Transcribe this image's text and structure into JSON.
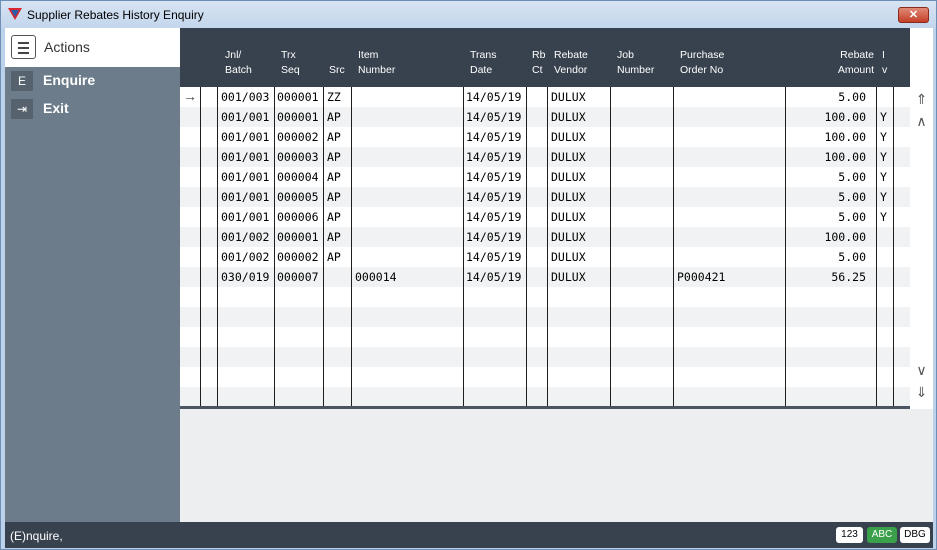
{
  "window": {
    "title": "Supplier Rebates History Enquiry",
    "close_label": "✕"
  },
  "sidebar": {
    "header": "Actions",
    "items": [
      {
        "icon": "E",
        "label": "Enquire"
      },
      {
        "icon": "⇥",
        "label": "Exit"
      }
    ]
  },
  "grid": {
    "columns": [
      {
        "key": "batch",
        "label": "Jnl/\nBatch"
      },
      {
        "key": "seq",
        "label": "Trx\nSeq"
      },
      {
        "key": "src",
        "label": "\nSrc"
      },
      {
        "key": "item",
        "label": "Item\nNumber"
      },
      {
        "key": "date",
        "label": "Trans\nDate"
      },
      {
        "key": "ct",
        "label": "Rb\nCt"
      },
      {
        "key": "vendor",
        "label": "Rebate\nVendor"
      },
      {
        "key": "job",
        "label": "Job\nNumber"
      },
      {
        "key": "po",
        "label": "Purchase\nOrder No"
      },
      {
        "key": "amount",
        "label": "Rebate\nAmount"
      },
      {
        "key": "flag",
        "label": "I\nv"
      }
    ],
    "rows": [
      {
        "batch": "001/003",
        "seq": "000001",
        "src": "ZZ",
        "item": "",
        "date": "14/05/19",
        "ct": "",
        "vendor": "DULUX",
        "job": "",
        "po": "",
        "amount": "5.00",
        "flag": ""
      },
      {
        "batch": "001/001",
        "seq": "000001",
        "src": "AP",
        "item": "",
        "date": "14/05/19",
        "ct": "",
        "vendor": "DULUX",
        "job": "",
        "po": "",
        "amount": "100.00",
        "flag": "Y"
      },
      {
        "batch": "001/001",
        "seq": "000002",
        "src": "AP",
        "item": "",
        "date": "14/05/19",
        "ct": "",
        "vendor": "DULUX",
        "job": "",
        "po": "",
        "amount": "100.00",
        "flag": "Y"
      },
      {
        "batch": "001/001",
        "seq": "000003",
        "src": "AP",
        "item": "",
        "date": "14/05/19",
        "ct": "",
        "vendor": "DULUX",
        "job": "",
        "po": "",
        "amount": "100.00",
        "flag": "Y"
      },
      {
        "batch": "001/001",
        "seq": "000004",
        "src": "AP",
        "item": "",
        "date": "14/05/19",
        "ct": "",
        "vendor": "DULUX",
        "job": "",
        "po": "",
        "amount": "5.00",
        "flag": "Y"
      },
      {
        "batch": "001/001",
        "seq": "000005",
        "src": "AP",
        "item": "",
        "date": "14/05/19",
        "ct": "",
        "vendor": "DULUX",
        "job": "",
        "po": "",
        "amount": "5.00",
        "flag": "Y"
      },
      {
        "batch": "001/001",
        "seq": "000006",
        "src": "AP",
        "item": "",
        "date": "14/05/19",
        "ct": "",
        "vendor": "DULUX",
        "job": "",
        "po": "",
        "amount": "5.00",
        "flag": "Y"
      },
      {
        "batch": "001/002",
        "seq": "000001",
        "src": "AP",
        "item": "",
        "date": "14/05/19",
        "ct": "",
        "vendor": "DULUX",
        "job": "",
        "po": "",
        "amount": "100.00",
        "flag": ""
      },
      {
        "batch": "001/002",
        "seq": "000002",
        "src": "AP",
        "item": "",
        "date": "14/05/19",
        "ct": "",
        "vendor": "DULUX",
        "job": "",
        "po": "",
        "amount": "5.00",
        "flag": ""
      },
      {
        "batch": "030/019",
        "seq": "000007",
        "src": "",
        "item": "000014",
        "date": "14/05/19",
        "ct": "",
        "vendor": "DULUX",
        "job": "",
        "po": "P000421",
        "amount": "56.25",
        "flag": ""
      }
    ],
    "current_row_marker": "→"
  },
  "scroll": {
    "top": "⇑",
    "up": "∧",
    "down": "∨",
    "bottom": "⇓"
  },
  "status": {
    "text": "(E)nquire,",
    "badges": [
      "123",
      "ABC",
      "DBG"
    ]
  },
  "colors": {
    "header_bg": "#38424e",
    "sidebar_bg": "#6c7c8b",
    "abc_badge": "#3aa04a"
  }
}
